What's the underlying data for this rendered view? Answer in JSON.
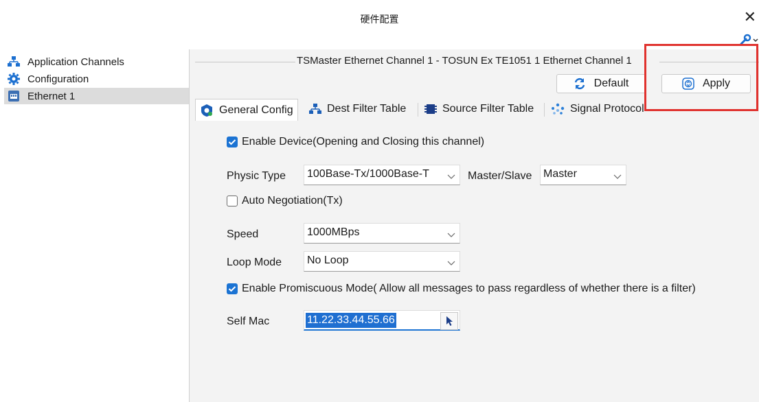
{
  "window": {
    "title": "硬件配置",
    "close_glyph": "✕"
  },
  "toolbar": {
    "tools_icon": "wrench-icon"
  },
  "sidebar": {
    "items": [
      {
        "label": "Application Channels",
        "icon": "network-icon",
        "selected": false
      },
      {
        "label": "Configuration",
        "icon": "gear-icon",
        "selected": false
      },
      {
        "label": "Ethernet 1",
        "icon": "ethernet-port-icon",
        "selected": true
      }
    ]
  },
  "main": {
    "group_title": "TSMaster Ethernet Channel 1 - TOSUN Ex TE1051 1 Ethernet Channel 1",
    "default_label": "Default",
    "apply_label": "Apply",
    "highlight_color": "#e0312d",
    "tabs": [
      {
        "label": "General Config",
        "icon": "shield-gear-icon",
        "active": true
      },
      {
        "label": "Dest Filter Table",
        "icon": "network-icon",
        "active": false
      },
      {
        "label": "Source Filter Table",
        "icon": "list-icon",
        "active": false
      },
      {
        "label": "Signal Protocol",
        "icon": "dots-icon",
        "active": false
      }
    ],
    "general": {
      "enable_device_label": "Enable Device(Opening and Closing this channel)",
      "enable_device_checked": true,
      "physic_type_label": "Physic Type",
      "physic_type_value": "100Base-Tx/1000Base-T",
      "master_slave_label": "Master/Slave",
      "master_slave_value": "Master",
      "auto_neg_label": "Auto Negotiation(Tx)",
      "auto_neg_checked": false,
      "speed_label": "Speed",
      "speed_value": "1000MBps",
      "loop_mode_label": "Loop Mode",
      "loop_mode_value": "No Loop",
      "promiscuous_label": "Enable Promiscuous Mode( Allow all messages to pass regardless of whether there is a filter)",
      "promiscuous_checked": true,
      "self_mac_label": "Self Mac",
      "self_mac_value": "11.22.33.44.55.66"
    }
  },
  "colors": {
    "accent": "#1b73d3",
    "panel_bg": "#f3f3f3",
    "selection": "#dcdcdc"
  }
}
